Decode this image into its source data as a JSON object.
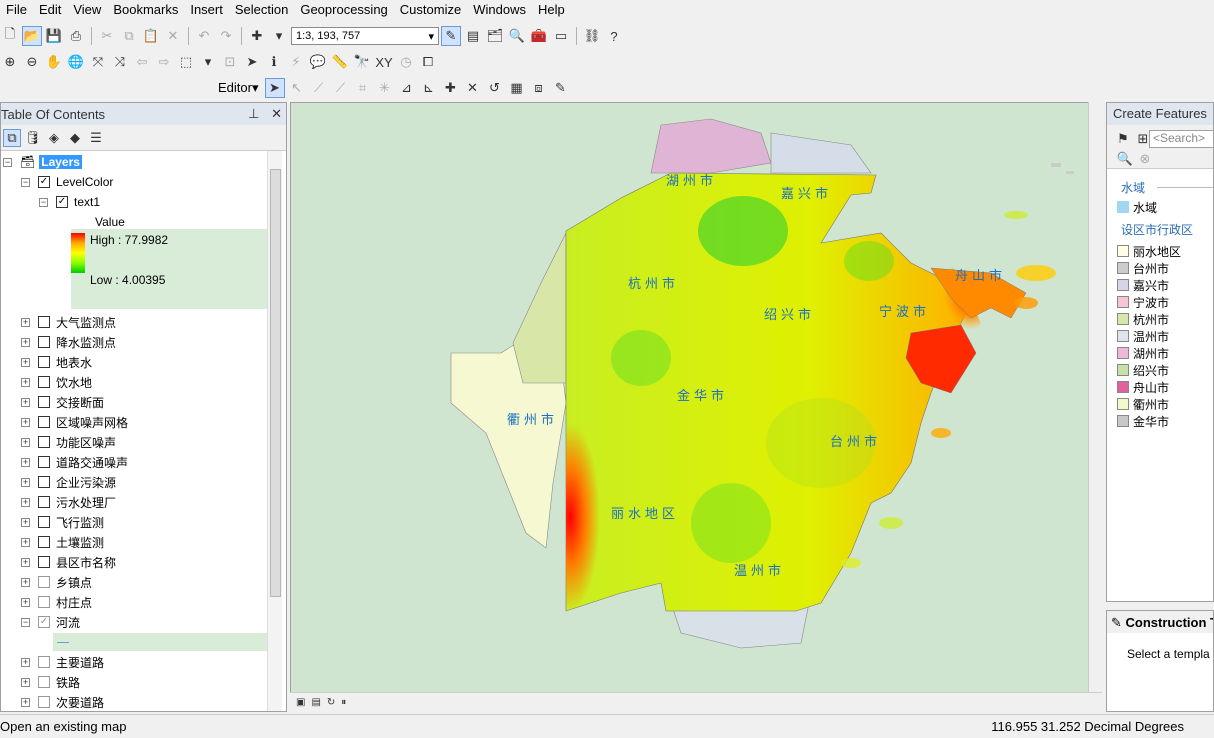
{
  "menu": [
    "File",
    "Edit",
    "View",
    "Bookmarks",
    "Insert",
    "Selection",
    "Geoprocessing",
    "Customize",
    "Windows",
    "Help"
  ],
  "toolbar": {
    "scale": "1:3, 193, 757",
    "editor_label": "Editor"
  },
  "toc": {
    "title": "Table Of Contents",
    "pin": "ᵖ",
    "close": "✕",
    "layers_label": "Layers",
    "level_layer": "LevelColor",
    "text_layer": "text1",
    "value_label": "Value",
    "high_label": "High : 77.9982",
    "low_label": "Low : 4.00395",
    "layers": [
      "大气监测点",
      "降水监测点",
      "地表水",
      "饮水地",
      "交接断面",
      "区域噪声网格",
      "功能区噪声",
      "道路交通噪声",
      "企业污染源",
      "污水处理厂",
      "飞行监测",
      "土壤监测",
      "县区市名称",
      "乡镇点",
      "村庄点",
      "河流",
      "主要道路",
      "铁路",
      "次要道路"
    ]
  },
  "map": {
    "labels": [
      "湖州市",
      "嘉兴市",
      "杭州市",
      "舟山市",
      "绍兴市",
      "宁波市",
      "金华市",
      "衢州市",
      "台州市",
      "丽水地区",
      "温州市"
    ]
  },
  "create_features": {
    "title": "Create Features",
    "search_placeholder": "<Search>",
    "group_water": "水域",
    "water_item": "水域",
    "group_admin": "设区市行政区",
    "items": [
      {
        "name": "丽水地区",
        "color": "#fffde6"
      },
      {
        "name": "台州市",
        "color": "#cccccc"
      },
      {
        "name": "嘉兴市",
        "color": "#d5d5e8"
      },
      {
        "name": "宁波市",
        "color": "#f5c5d5"
      },
      {
        "name": "杭州市",
        "color": "#d8e6a8"
      },
      {
        "name": "温州市",
        "color": "#dde6ee"
      },
      {
        "name": "湖州市",
        "color": "#f0b8d8"
      },
      {
        "name": "绍兴市",
        "color": "#c8e0a8"
      },
      {
        "name": "舟山市",
        "color": "#e060a0"
      },
      {
        "name": "衢州市",
        "color": "#f5f8c8"
      },
      {
        "name": "金华市",
        "color": "#c8c8c8"
      }
    ]
  },
  "construction": {
    "title": "Construction T",
    "body": "Select a templa"
  },
  "status": {
    "message": "Open an existing map",
    "coords": "116.955  31.252 Decimal Degrees"
  },
  "colors": {
    "selection": "#3399ff",
    "map_bg": "#cfe5cf",
    "label_blue": "#1a6fc8"
  }
}
